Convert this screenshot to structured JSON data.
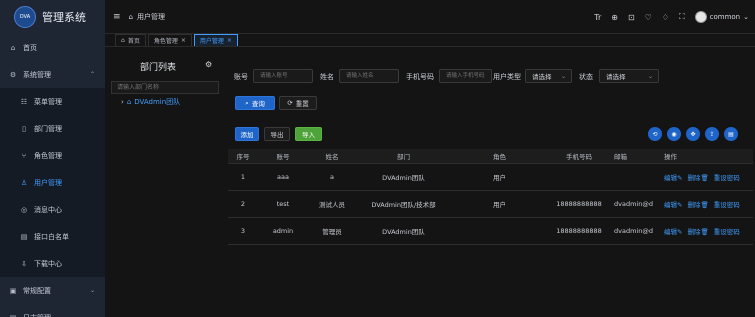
{
  "app": {
    "logo_badge": "DVA",
    "title": "管理系统"
  },
  "sidebar": {
    "items": [
      {
        "icon": "⌂",
        "icon_name": "home-icon",
        "label": "首页"
      },
      {
        "icon": "⚙",
        "icon_name": "settings-icon",
        "label": "系统管理",
        "arrow": "⌃"
      },
      {
        "icon": "☷",
        "icon_name": "menu-icon",
        "label": "菜单管理"
      },
      {
        "icon": "▯",
        "icon_name": "department-icon",
        "label": "部门管理"
      },
      {
        "icon": "⑂",
        "icon_name": "role-icon",
        "label": "角色管理"
      },
      {
        "icon": "♙",
        "icon_name": "user-icon",
        "label": "用户管理",
        "active": true
      },
      {
        "icon": "◎",
        "icon_name": "message-icon",
        "label": "消息中心"
      },
      {
        "icon": "▤",
        "icon_name": "whitelist-icon",
        "label": "接口白名单"
      },
      {
        "icon": "⇩",
        "icon_name": "download-icon",
        "label": "下载中心"
      },
      {
        "icon": "▣",
        "icon_name": "config-icon",
        "label": "常规配置",
        "arrow": "⌄"
      },
      {
        "icon": "▤",
        "icon_name": "log-icon",
        "label": "日志管理",
        "arrow": "⌄"
      }
    ]
  },
  "header": {
    "hamburger": "≡",
    "breadcrumb": {
      "icon": "⌂",
      "label": "用户管理"
    },
    "icons": [
      "Tr",
      "⊕",
      "⊡",
      "♡",
      "♢",
      "⛶"
    ],
    "user": "common",
    "user_chevron": "⌄"
  },
  "tabs": [
    {
      "icon": "⌂",
      "label": "首页",
      "close": ""
    },
    {
      "icon": "",
      "label": "角色管理",
      "close": "×"
    },
    {
      "icon": "",
      "label": "用户管理",
      "close": "×",
      "active": true
    }
  ],
  "dept": {
    "title": "部门列表",
    "settings_icon": "⚙",
    "search_placeholder": "请输入部门名称",
    "tree_root": "DVAdmin团队",
    "tree_arrow": "›",
    "tree_icon": "⌂"
  },
  "filters": {
    "account_label": "账号",
    "account_placeholder": "请输入账号",
    "name_label": "姓名",
    "name_placeholder": "请输入姓名",
    "phone_label": "手机号码",
    "phone_placeholder": "请输入手机号码",
    "type_label": "用户类型",
    "type_value": "请选择",
    "status_label": "状态",
    "status_value": "请选择",
    "search_button": "查询",
    "reset_button": "重置"
  },
  "toolbar": {
    "add": "添加",
    "export": "导出",
    "import": "导入",
    "circle_icons": [
      "⟲",
      "◉",
      "✥",
      "⇪",
      "▤"
    ]
  },
  "table": {
    "columns": [
      "序号",
      "账号",
      "姓名",
      "部门",
      "角色",
      "手机号码",
      "邮箱",
      "操作"
    ],
    "rows": [
      [
        "1",
        "aaa",
        "a",
        "DVAdmin团队",
        "用户",
        "",
        ""
      ],
      [
        "2",
        "test",
        "测试人员",
        "DVAdmin团队/技术部",
        "用户",
        "18888888888",
        "dvadmin@d"
      ],
      [
        "3",
        "admin",
        "管理员",
        "DVAdmin团队",
        "",
        "18888888888",
        "dvadmin@d"
      ]
    ],
    "actions": [
      "编辑",
      "删除",
      "重设密码"
    ],
    "action_icons": [
      "✎",
      "🗑"
    ]
  },
  "colors": {
    "accent": "#409eff",
    "primary_button": "#1f64c8",
    "success_button": "#4ea33a",
    "sidebar_bg": "#1f2633"
  }
}
